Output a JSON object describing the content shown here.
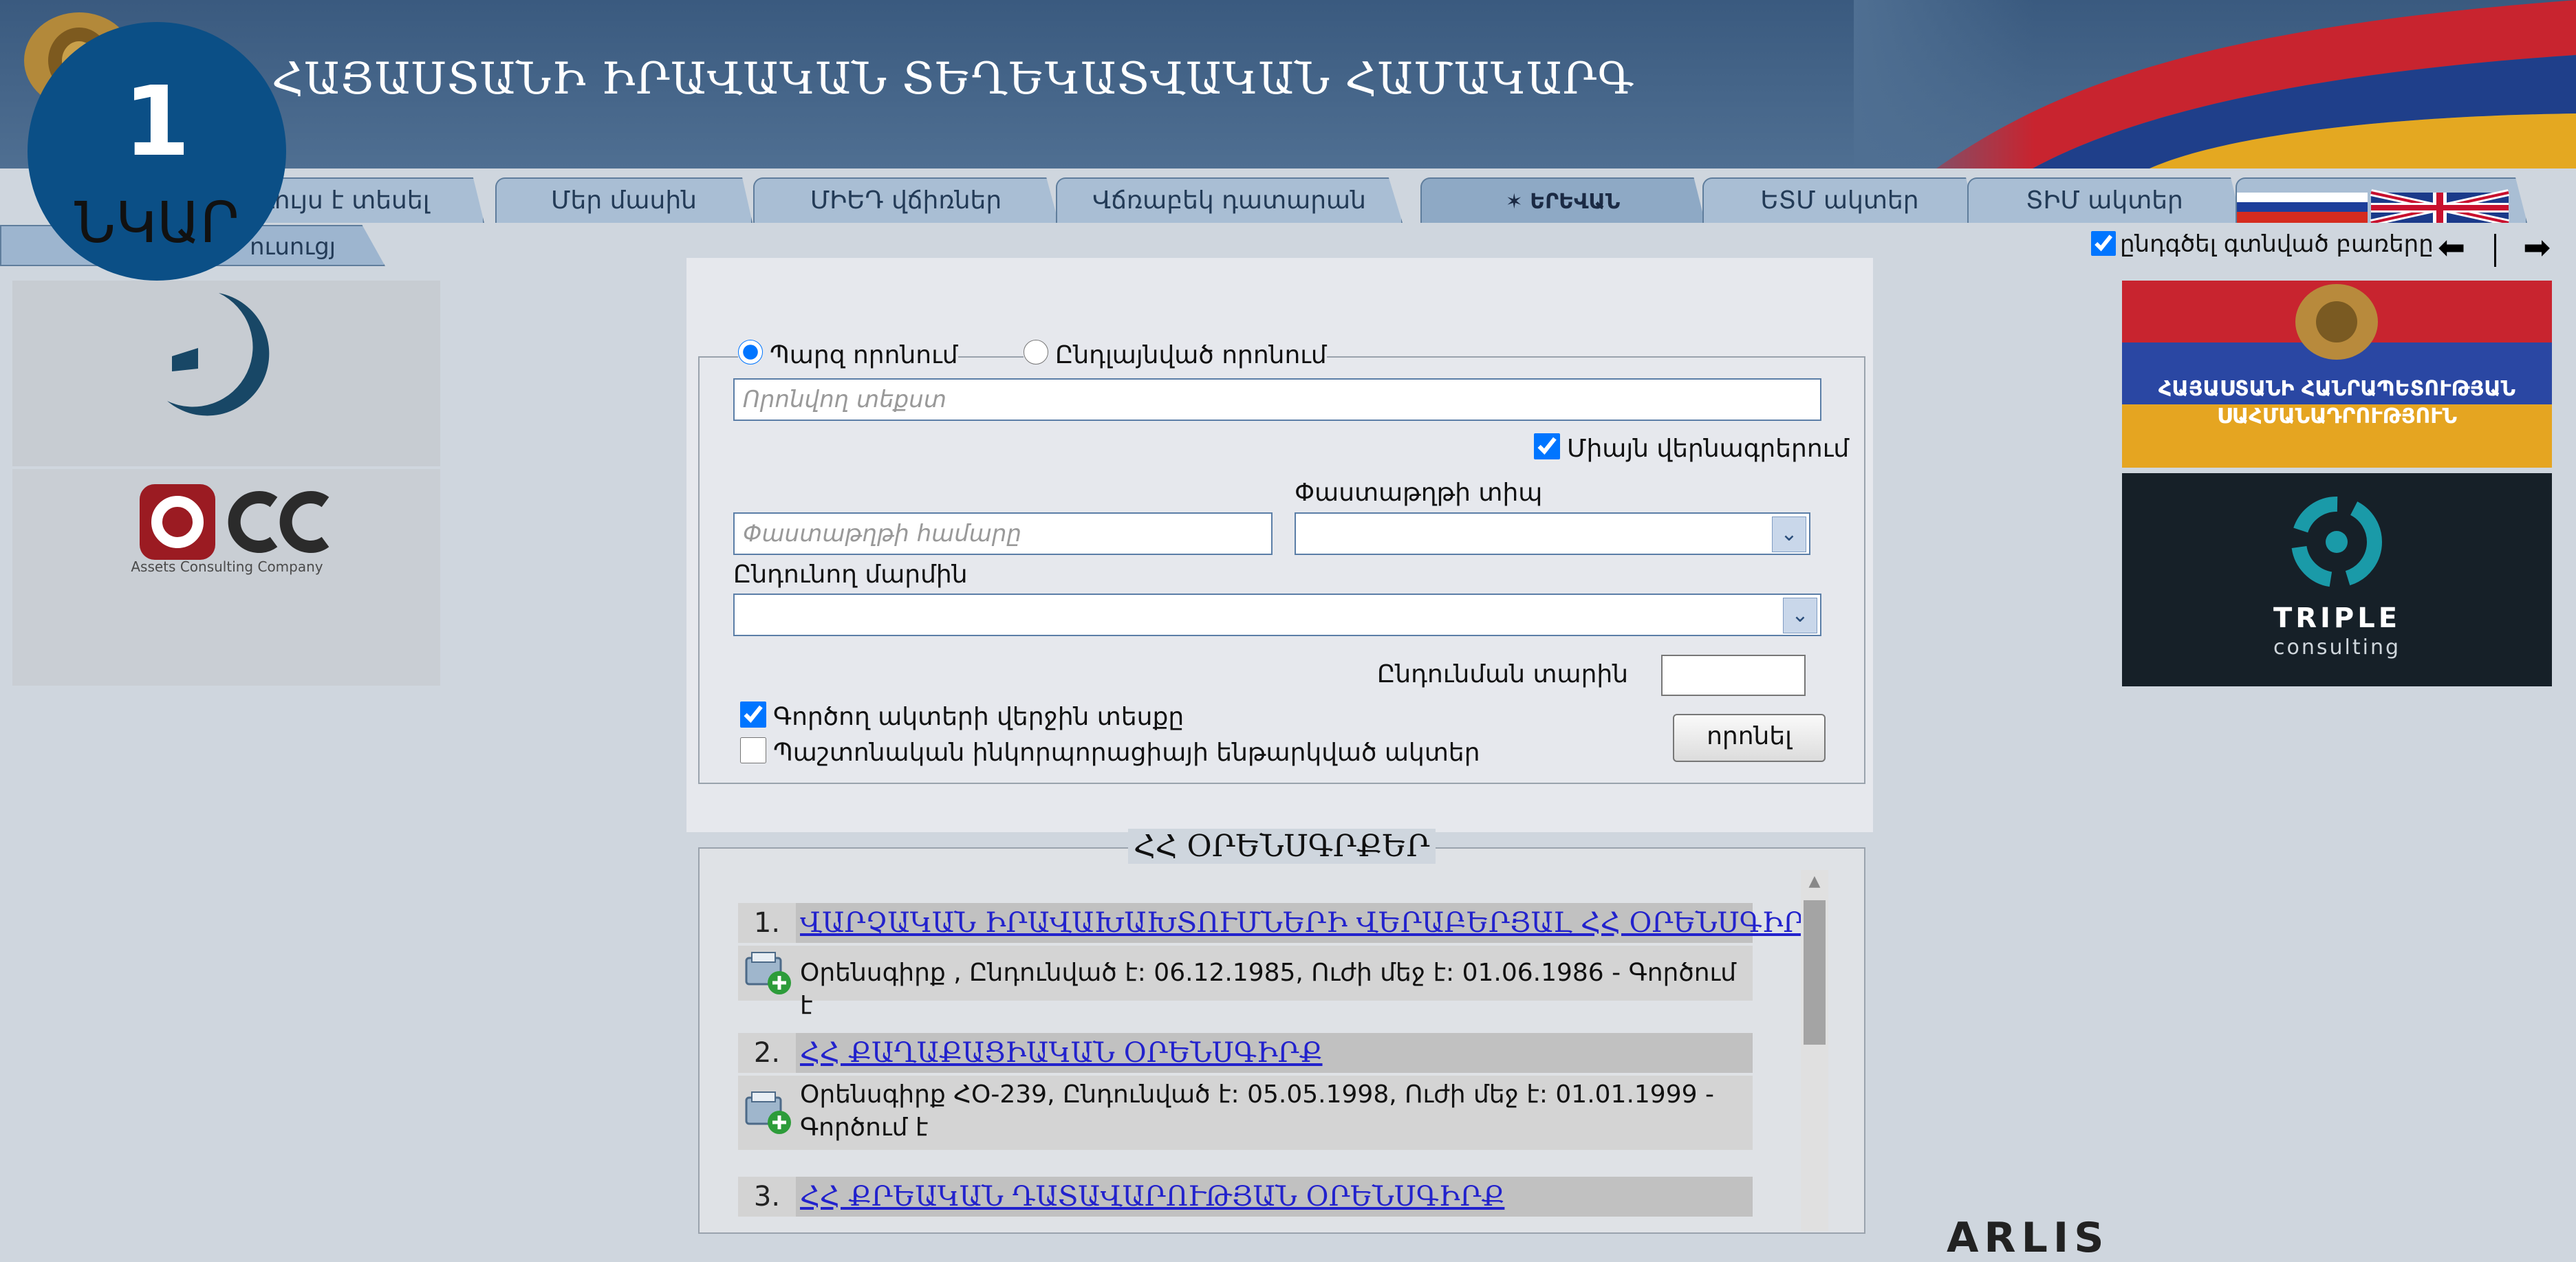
{
  "header": {
    "title": "ՀԱՅԱՍՏԱՆԻ ԻՐԱՎԱԿԱՆ ՏԵՂԵԿԱՏՎԱԿԱՆ ՀԱՄԱԿԱՐԳ",
    "badge_number": "1",
    "badge_label": "ՆԿԱՐ"
  },
  "tabs": [
    {
      "label": "Լույս է տեսել"
    },
    {
      "label": "Մեր մասին"
    },
    {
      "label": "ՄԻԵԴ վճիռներ"
    },
    {
      "label": "Վճռաբեկ դատարան"
    },
    {
      "label": "ԵՐԵՎԱՆ"
    },
    {
      "label": "ԵՏՄ ակտեր"
    },
    {
      "label": "ՏԻՄ ակտեր"
    }
  ],
  "subtab": {
    "label": "ուսուցյ"
  },
  "right_controls": {
    "highlight_label": "ընդգծել գտնված բառերը",
    "highlight_checked": true
  },
  "ads": {
    "acc_caption": "Assets Consulting Company",
    "constitution_line1": "ՀԱՅԱՍՏԱՆԻ ՀԱՆՐԱՊԵՏՈՒԹՅԱՆ",
    "constitution_line2": "ՍԱՀՄԱՆԱԴՐՈՒԹՅՈՒՆ",
    "triple_line1": "TRIPLE",
    "triple_line2": "consulting"
  },
  "search": {
    "simple_label": "Պարզ որոնում",
    "advanced_label": "Ընդլայնված որոնում",
    "text_placeholder": "Որոնվող տեքստ",
    "titles_only_label": "Միայն վերնագրերում",
    "doc_type_label": "Փաստաթղթի տիպ",
    "doc_number_placeholder": "Փաստաթղթի համարը",
    "adopting_body_label": "Ընդունող մարմին",
    "year_label": "Ընդունման տարին",
    "current_versions_label": "Գործող ակտերի վերջին տեսքը",
    "incorporated_label": "Պաշտոնական ինկորպորացիայի ենթարկված ակտեր",
    "search_button": "որոնել"
  },
  "results": {
    "title": "ՀՀ ՕՐԵՆՍԳՐՔԵՐ",
    "items": [
      {
        "num": "1.",
        "title": "ՎԱՐՉԱԿԱՆ ԻՐԱՎԱԽԱԽՏՈՒՄՆԵՐԻ ՎԵՐԱԲԵՐՅԱԼ ՀՀ ՕՐԵՆՍԳԻՐՔ",
        "meta": "Օրենսգիրք   ,     Ընդունված է: 06.12.1985,     Ուժի մեջ է: 01.06.1986  -   Գործում է"
      },
      {
        "num": "2.",
        "title": "ՀՀ ՔԱՂԱՔԱՑԻԱԿԱՆ ՕՐԵՆՍԳԻՐՔ",
        "meta": "Օրենսգիրք   ՀՕ-239,     Ընդունված է: 05.05.1998,     Ուժի մեջ է: 01.01.1999  -  Գործում է"
      },
      {
        "num": "3.",
        "title": "ՀՀ ՔՐԵԱԿԱՆ ԴԱՏԱՎԱՐՈՒԹՅԱՆ ՕՐԵՆՍԳԻՐՔ"
      }
    ]
  },
  "bottom_logo": "ARLIS"
}
